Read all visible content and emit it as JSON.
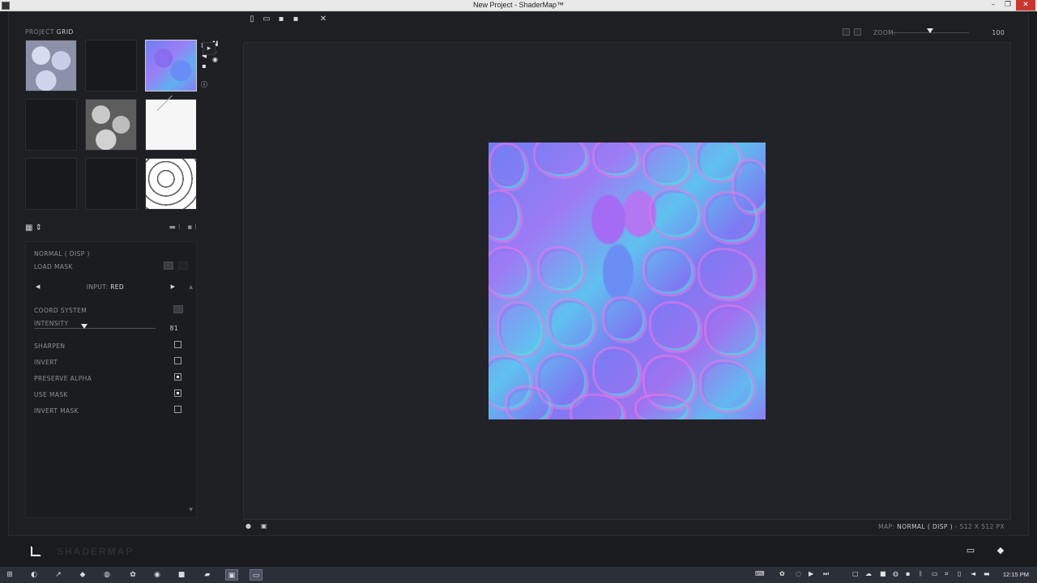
{
  "window": {
    "title": "New Project - ShaderMap™"
  },
  "toolbar": {
    "items": [
      {
        "name": "new-file-icon",
        "glyph": "▯"
      },
      {
        "name": "open-folder-icon",
        "glyph": "▭"
      },
      {
        "name": "save-icon",
        "glyph": "▪"
      },
      {
        "name": "save-as-icon",
        "glyph": "▪"
      },
      {
        "name": "settings-tools-icon",
        "glyph": "✕"
      }
    ]
  },
  "left_panel": {
    "project_label": "PROJECT",
    "project_value": "GRID",
    "properties": {
      "map_name": "NORMAL ( DISP )",
      "load_mask": "LOAD MASK",
      "input_label": "INPUT:",
      "input_value": "RED",
      "coord_system": "COORD SYSTEM",
      "intensity_label": "INTENSITY",
      "intensity_value": "81",
      "intensity_fraction": 0.41,
      "options": [
        {
          "label": "SHARPEN",
          "checked": false
        },
        {
          "label": "INVERT",
          "checked": false
        },
        {
          "label": "PRESERVE ALPHA",
          "checked": true
        },
        {
          "label": "USE MASK",
          "checked": true
        },
        {
          "label": "INVERT MASK",
          "checked": false
        }
      ]
    }
  },
  "zoom": {
    "label": "ZOOM:",
    "value": "100",
    "level_fraction": 0.55
  },
  "status": {
    "map_label": "MAP:",
    "map_value": "NORMAL ( DISP )",
    "size_text": "- 512 X 512 PX"
  },
  "bottombar": {
    "logo_text": "SHADERMAP"
  },
  "taskbar": {
    "clock": "12:15 PM"
  }
}
